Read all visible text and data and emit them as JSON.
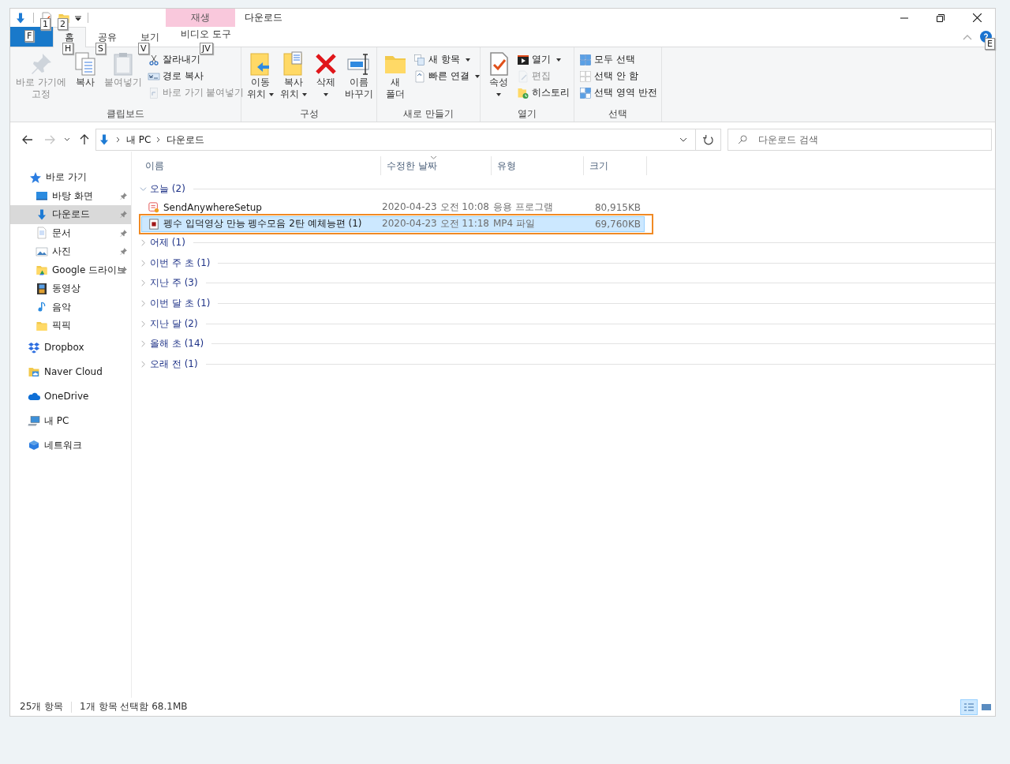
{
  "quick_access": [
    {
      "kind": "button"
    },
    {
      "kind": "button",
      "keytip": "1"
    },
    {
      "kind": "button",
      "keytip": "2"
    },
    {
      "kind": "menu"
    }
  ],
  "title_bar": {
    "contextual_header": "재생",
    "title": "다운로드"
  },
  "tabs": [
    {
      "kind": "file",
      "keytip": "F",
      "selected": false
    },
    {
      "kind": "normal",
      "label": "홈",
      "keytip": "H",
      "selected": true
    },
    {
      "kind": "normal",
      "label": "공유",
      "keytip": "S",
      "selected": false
    },
    {
      "kind": "normal",
      "label": "보기",
      "keytip": "V",
      "selected": false
    },
    {
      "kind": "contextual",
      "label": "비디오 도구",
      "keytip": "JV",
      "selected": false
    }
  ],
  "help": {
    "keytip": "E"
  },
  "ribbon": [
    {
      "label": "클립보드",
      "items": [
        {
          "kind": "large",
          "lines": [
            "바로 가기에",
            "고정"
          ],
          "disabled": true,
          "dropdown": false
        },
        {
          "kind": "large",
          "lines": [
            "복사"
          ],
          "disabled": false,
          "dropdown": false
        },
        {
          "kind": "large",
          "lines": [
            "붙여넣기"
          ],
          "disabled": true,
          "dropdown": false
        },
        {
          "kind": "stack",
          "items": [
            {
              "label": "잘라내기",
              "disabled": false,
              "dropdown": false
            },
            {
              "label": "경로 복사",
              "disabled": false,
              "dropdown": false
            },
            {
              "label": "바로 가기 붙여넣기",
              "disabled": true,
              "dropdown": false
            }
          ]
        }
      ]
    },
    {
      "label": "구성",
      "items": [
        {
          "kind": "large",
          "lines": [
            "이동",
            "위치"
          ],
          "disabled": false,
          "dropdown": true
        },
        {
          "kind": "large",
          "lines": [
            "복사",
            "위치"
          ],
          "disabled": false,
          "dropdown": true
        },
        {
          "kind": "large",
          "lines": [
            "삭제"
          ],
          "disabled": false,
          "dropdown": true
        },
        {
          "kind": "large",
          "lines": [
            "이름",
            "바꾸기"
          ],
          "disabled": false,
          "dropdown": false
        }
      ]
    },
    {
      "label": "새로 만들기",
      "items": [
        {
          "kind": "large",
          "lines": [
            "새",
            "폴더"
          ],
          "disabled": false,
          "dropdown": false
        },
        {
          "kind": "stack",
          "items": [
            {
              "label": "새 항목",
              "disabled": false,
              "dropdown": true
            },
            {
              "label": "빠른 연결",
              "disabled": false,
              "dropdown": true
            }
          ]
        }
      ]
    },
    {
      "label": "열기",
      "items": [
        {
          "kind": "large",
          "lines": [
            "속성"
          ],
          "disabled": false,
          "dropdown": true
        },
        {
          "kind": "stack",
          "items": [
            {
              "label": "열기",
              "disabled": false,
              "dropdown": true
            },
            {
              "label": "편집",
              "disabled": true,
              "dropdown": false
            },
            {
              "label": "히스토리",
              "disabled": false,
              "dropdown": false
            }
          ]
        }
      ]
    },
    {
      "label": "선택",
      "items": [
        {
          "kind": "stack",
          "items": [
            {
              "label": "모두 선택",
              "disabled": false,
              "dropdown": false
            },
            {
              "label": "선택 안 함",
              "disabled": false,
              "dropdown": false
            },
            {
              "label": "선택 영역 반전",
              "disabled": false,
              "dropdown": false
            }
          ]
        }
      ]
    }
  ],
  "address_bar": {
    "forward_disabled": true,
    "path": [
      "내 PC",
      "다운로드"
    ],
    "search_placeholder": "다운로드 검색"
  },
  "sidebar": [
    {
      "label": "바로 가기",
      "selected": false,
      "children": [
        {
          "label": "바탕 화면",
          "pinned": true,
          "selected": false
        },
        {
          "label": "다운로드",
          "pinned": true,
          "selected": true
        },
        {
          "label": "문서",
          "pinned": true,
          "selected": false
        },
        {
          "label": "사진",
          "pinned": true,
          "selected": false
        },
        {
          "label": "Google 드라이브",
          "pinned": true,
          "selected": false
        },
        {
          "label": "동영상",
          "pinned": false,
          "selected": false
        },
        {
          "label": "음악",
          "pinned": false,
          "selected": false
        },
        {
          "label": "픽픽",
          "pinned": false,
          "selected": false
        }
      ]
    },
    {
      "label": "Dropbox",
      "selected": false
    },
    {
      "label": "Naver Cloud",
      "selected": false
    },
    {
      "label": "OneDrive",
      "selected": false
    },
    {
      "label": "내 PC",
      "selected": false
    },
    {
      "label": "네트워크",
      "selected": false
    }
  ],
  "columns": [
    {
      "label": "이름",
      "sorted": false
    },
    {
      "label": "수정한 날짜",
      "sorted": true
    },
    {
      "label": "유형",
      "sorted": false
    },
    {
      "label": "크기",
      "sorted": false
    }
  ],
  "groups": [
    {
      "label": "오늘 (2)",
      "expanded": true,
      "files": [
        {
          "name": "SendAnywhereSetup",
          "date": "2020-04-23 오전 10:08",
          "type": "응용 프로그램",
          "size": "80,915KB",
          "selected": false,
          "outlined": false
        },
        {
          "name": "펭수 입덕영상 만능 펭수모음 2탄 예체능편 (1)",
          "date": "2020-04-23 오전 11:18",
          "type": "MP4 파일",
          "size": "69,760KB",
          "selected": true,
          "outlined": true
        }
      ]
    },
    {
      "label": "어제 (1)",
      "expanded": false
    },
    {
      "label": "이번 주 초 (1)",
      "expanded": false
    },
    {
      "label": "지난 주 (3)",
      "expanded": false
    },
    {
      "label": "이번 달 초 (1)",
      "expanded": false
    },
    {
      "label": "지난 달 (2)",
      "expanded": false
    },
    {
      "label": "올해 초 (14)",
      "expanded": false
    },
    {
      "label": "오래 전 (1)",
      "expanded": false
    }
  ],
  "status_bar": {
    "item_count": "25개 항목",
    "selection": "1개 항목 선택함 68.1MB",
    "views": [
      {
        "selected": true
      },
      {
        "selected": false
      }
    ]
  }
}
